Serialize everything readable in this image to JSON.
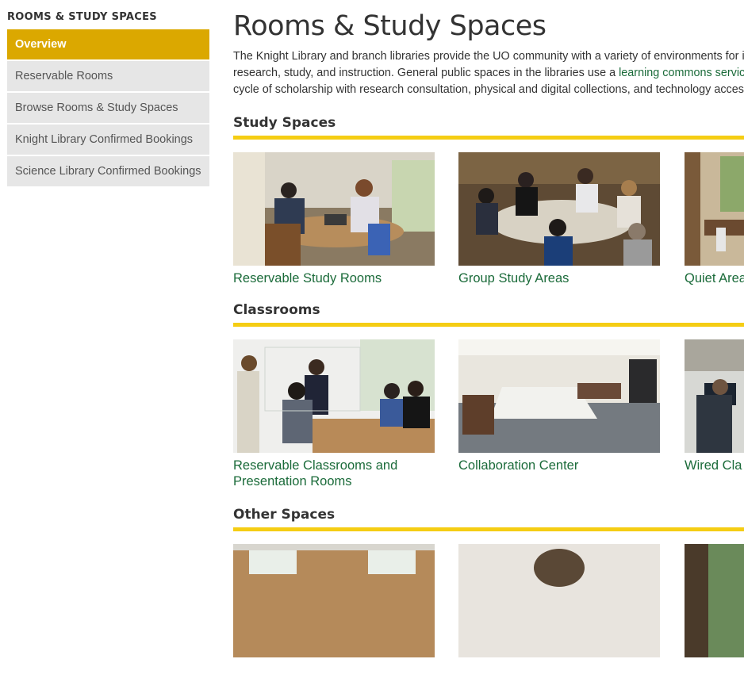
{
  "sidebar": {
    "heading": "ROOMS & STUDY SPACES",
    "items": [
      {
        "label": "Overview"
      },
      {
        "label": "Reservable Rooms"
      },
      {
        "label": "Browse Rooms & Study Spaces"
      },
      {
        "label": "Knight Library Confirmed Bookings"
      },
      {
        "label": "Science Library Confirmed Bookings"
      }
    ]
  },
  "main": {
    "title": "Rooms & Study Spaces",
    "intro": {
      "line1": "The Knight Library and branch libraries provide the UO community with a variety of environments for in",
      "line2_before": "research, study, and instruction. General public spaces in the libraries use a ",
      "line2_link": "learning commons service",
      "line3": "cycle of scholarship with research consultation, physical and digital collections, and technology access"
    },
    "sections": [
      {
        "heading": "Study Spaces",
        "cards": [
          {
            "caption": "Reservable Study Rooms"
          },
          {
            "caption": "Group Study Areas"
          },
          {
            "caption": "Quiet Area"
          }
        ]
      },
      {
        "heading": "Classrooms",
        "cards": [
          {
            "caption_line1": "Reservable Classrooms and",
            "caption_line2": "Presentation Rooms"
          },
          {
            "caption": "Collaboration Center"
          },
          {
            "caption": "Wired Cla"
          }
        ]
      },
      {
        "heading": "Other Spaces",
        "cards": [
          {},
          {},
          {}
        ]
      }
    ]
  },
  "colors": {
    "accent_gold": "#dba800",
    "rule_yellow": "#f5cd13",
    "link_green": "#1b6b3a",
    "sidebar_gray": "#e6e6e6"
  }
}
